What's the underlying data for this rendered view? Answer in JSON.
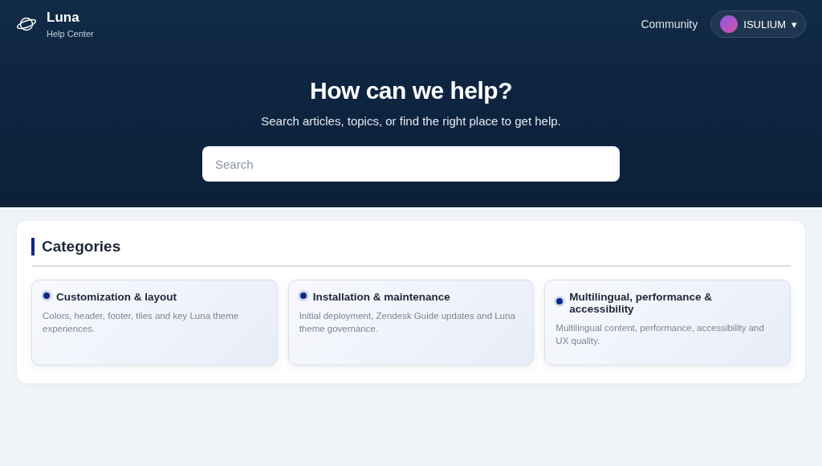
{
  "brand": {
    "name": "Luna",
    "subtitle": "Help Center"
  },
  "nav": {
    "link": "Community",
    "user": "ISULIUM",
    "caret": "▾"
  },
  "hero": {
    "title": "How can we help?",
    "subtitle": "Search articles, topics, or find the right place to get help.",
    "search": {
      "placeholder": "Search"
    }
  },
  "categories": {
    "title": "Categories",
    "items": [
      {
        "title": "Customization & layout",
        "description": "Colors, header, footer, tiles and key Luna theme experiences."
      },
      {
        "title": "Installation & maintenance",
        "description": "Initial deployment, Zendesk Guide updates and Luna theme governance."
      },
      {
        "title": "Multilingual, performance & accessibility",
        "description": "Multilingual content, performance, accessibility and UX quality."
      }
    ]
  }
}
